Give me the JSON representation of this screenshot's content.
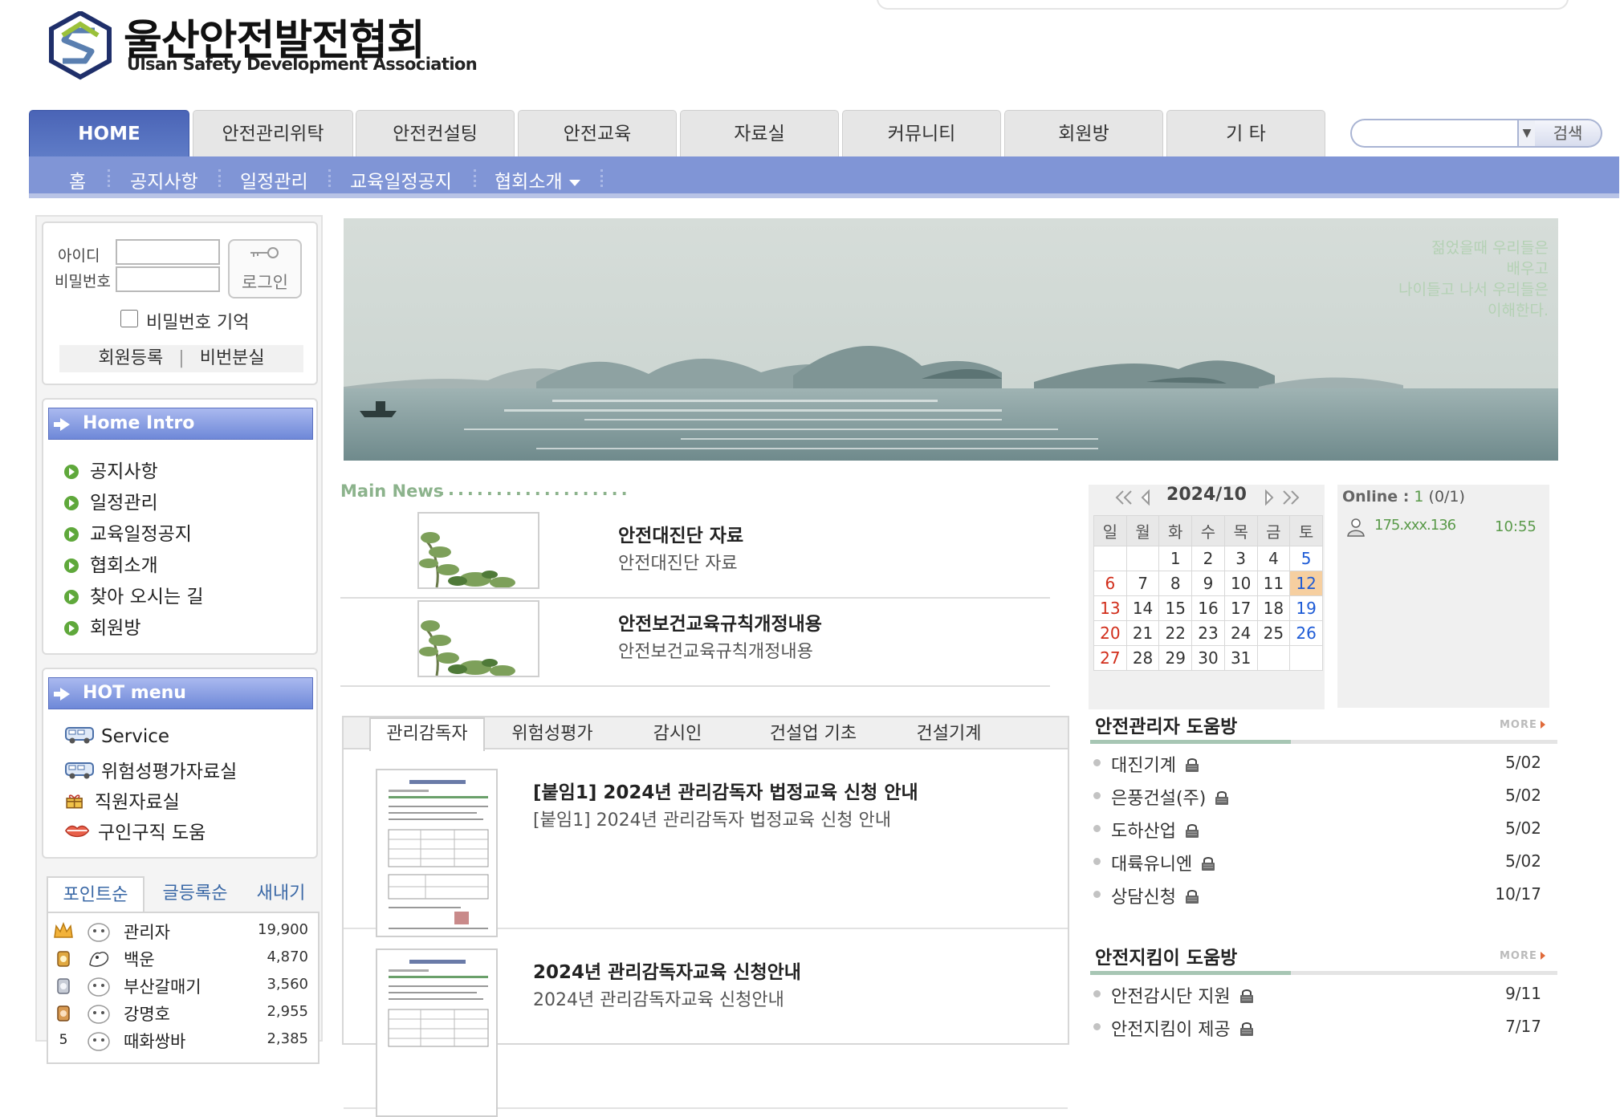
{
  "header": {
    "title": "울산안전발전협회",
    "subtitle": "Ulsan Safety Development Association"
  },
  "main_tabs": [
    "HOME",
    "안전관리위탁",
    "안전컨설팅",
    "안전교육",
    "자료실",
    "커뮤니티",
    "회원방",
    "기 타"
  ],
  "sub_nav": [
    "홈",
    "공지사항",
    "일정관리",
    "교육일정공지",
    "협회소개"
  ],
  "search": {
    "button": "검색",
    "value": ""
  },
  "login": {
    "id_label": "아이디",
    "pw_label": "비밀번호",
    "button": "로그인",
    "remember": "비밀번호 기억",
    "register": "회원등록",
    "divider": "|",
    "lost_pw": "비번분실"
  },
  "home_intro": {
    "title": "Home Intro",
    "items": [
      "공지사항",
      "일정관리",
      "교육일정공지",
      "협회소개",
      "찾아 오시는 길",
      "회원방"
    ]
  },
  "hot_menu": {
    "title": "HOT menu",
    "items": [
      "Service",
      "위험성평가자료실",
      "직원자료실",
      "구인구직 도움"
    ]
  },
  "ranking": {
    "tabs": [
      "포인트순",
      "글등록순",
      "새내기"
    ],
    "rows": [
      {
        "rank": "1",
        "name": "관리자",
        "points": "19,900"
      },
      {
        "rank": "2",
        "name": "백운",
        "points": "4,870"
      },
      {
        "rank": "3",
        "name": "부산갈매기",
        "points": "3,560"
      },
      {
        "rank": "4",
        "name": "강명호",
        "points": "2,955"
      },
      {
        "rank": "5",
        "name": "때화쌍바",
        "points": "2,385"
      }
    ]
  },
  "banner": {
    "quote": [
      "젊었을때 우리들은",
      "배우고",
      "나이들고 나서 우리들은",
      "이해한다."
    ]
  },
  "main_news": {
    "title": "Main News",
    "dots": "....................",
    "items": [
      {
        "title": "안전대진단 자료",
        "summary": "안전대진단 자료"
      },
      {
        "title": "안전보건교육규칙개정내용",
        "summary": "안전보건교육규칙개정내용"
      }
    ]
  },
  "calendar": {
    "month": "2024/10",
    "weekdays": [
      "일",
      "월",
      "화",
      "수",
      "목",
      "금",
      "토"
    ],
    "weeks": [
      [
        "",
        "",
        "1",
        "2",
        "3",
        "4",
        "5"
      ],
      [
        "6",
        "7",
        "8",
        "9",
        "10",
        "11",
        "12"
      ],
      [
        "13",
        "14",
        "15",
        "16",
        "17",
        "18",
        "19"
      ],
      [
        "20",
        "21",
        "22",
        "23",
        "24",
        "25",
        "26"
      ],
      [
        "27",
        "28",
        "29",
        "30",
        "31",
        "",
        ""
      ]
    ],
    "today": "12"
  },
  "online": {
    "label": "Online :",
    "count": "1",
    "detail": "(0/1)",
    "user_ip": "175.xxx.136",
    "time": "10:55"
  },
  "board_tabs": {
    "tabs": [
      "관리감독자",
      "위험성평가",
      "감시인",
      "건설업 기초",
      "건설기계"
    ],
    "items": [
      {
        "title": "[붙임1] 2024년 관리감독자 법정교육 신청 안내",
        "summary": "[붙임1] 2024년 관리감독자 법정교육 신청 안내"
      },
      {
        "title": "2024년 관리감독자교육 신청안내",
        "summary": "2024년 관리감독자교육 신청안내"
      }
    ]
  },
  "safety_manager_help": {
    "title": "안전관리자 도움방",
    "more": "MORE",
    "items": [
      {
        "title": "대진기계",
        "date": "5/02"
      },
      {
        "title": "은풍건설(주)",
        "date": "5/02"
      },
      {
        "title": "도하산업",
        "date": "5/02"
      },
      {
        "title": "대륙유니엔",
        "date": "5/02"
      },
      {
        "title": "상담신청",
        "date": "10/17"
      }
    ]
  },
  "safety_guard_help": {
    "title": "안전지킴이 도움방",
    "more": "MORE",
    "items": [
      {
        "title": "안전감시단 지원",
        "date": "9/11"
      },
      {
        "title": "안전지킴이 제공",
        "date": "7/17"
      }
    ]
  },
  "colors": {
    "nav_blue": "#5f7cc7",
    "subnav_blue": "#8095d6",
    "news_green": "#8cb38c",
    "sunday_red": "#d12d1a",
    "saturday_blue": "#1d5bd6",
    "today_bg": "#f6cfa0"
  }
}
